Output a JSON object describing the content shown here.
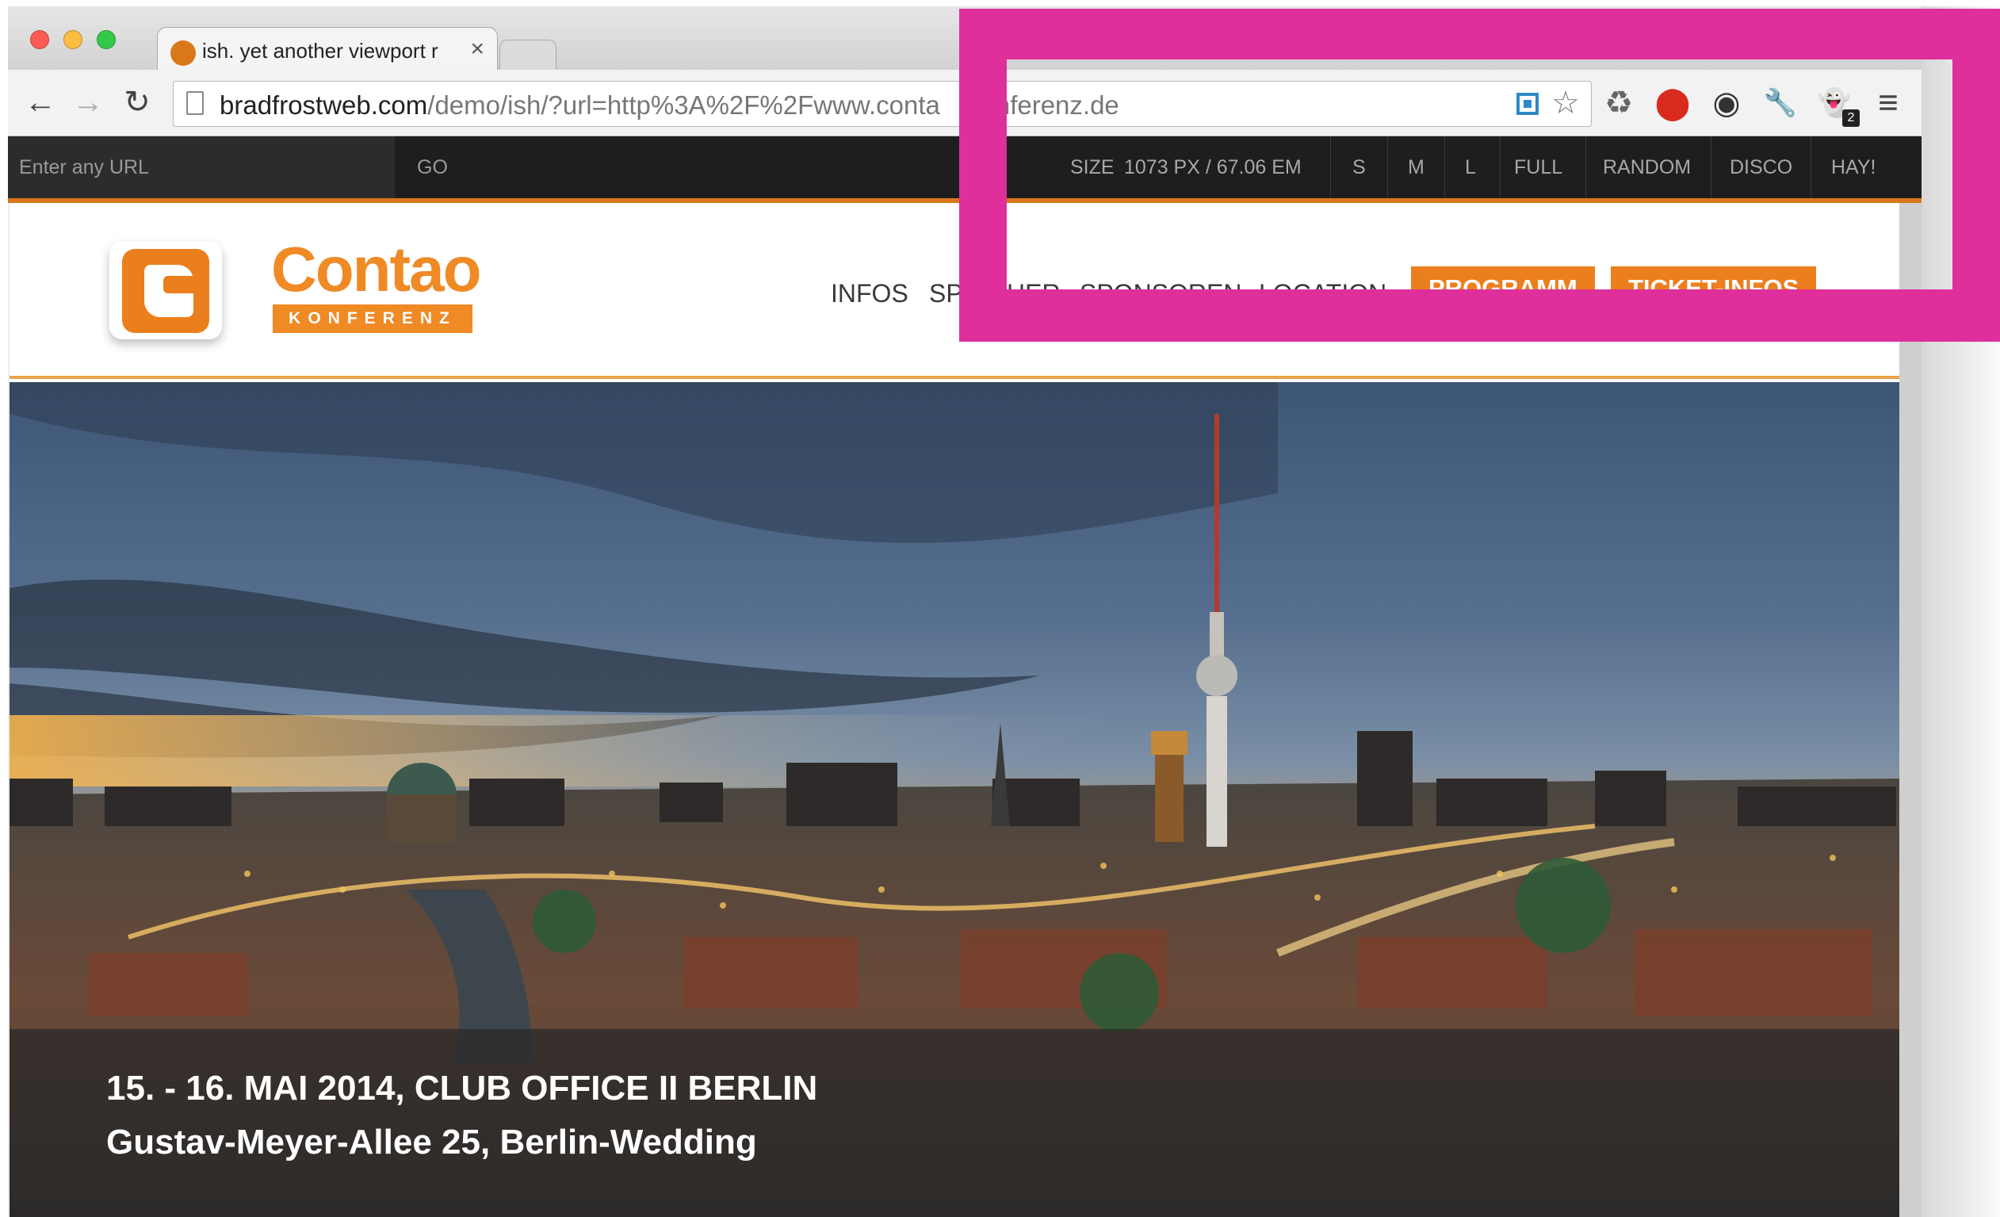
{
  "browser": {
    "tab": {
      "title": "ish. yet another viewport r",
      "close": "×"
    },
    "nav": {
      "back": "←",
      "forward": "→",
      "reload": "↻"
    },
    "url": {
      "domain": "bradfrostweb.com",
      "path": "/demo/ish/?url=http%3A%2F%2Fwww.conta",
      "path_end": "nferenz.de"
    },
    "star": "☆",
    "extensions": {
      "recycle": "♻",
      "stop": "⬤",
      "color": "◉",
      "wrench": "🔧",
      "ghost": "👻",
      "menu": "≡",
      "badge": "2"
    }
  },
  "ish_bar": {
    "input_placeholder": "Enter any URL",
    "go": "GO",
    "size_label": "SIZE",
    "size_value": "1073 PX / 67.06 EM",
    "buttons": [
      "S",
      "M",
      "L",
      "FULL",
      "RANDOM",
      "DISCO",
      "HAY!"
    ]
  },
  "site": {
    "logo": {
      "word": "Contao",
      "sub": "KONFERENZ"
    },
    "nav": [
      "INFOS",
      "SP",
      "HER",
      "SPONSOREN",
      "LOCATION"
    ],
    "cta": [
      "PROGRAMM",
      "TICKET-INFOS"
    ],
    "hero": {
      "line1": "15. - 16. MAI 2014, CLUB OFFICE II BERLIN",
      "line2": "Gustav-Meyer-Allee 25, Berlin-Wedding"
    }
  },
  "colors": {
    "accent": "#ec7f1d",
    "highlight": "#df2f9b",
    "ish_bar": "#1e1e1e"
  }
}
